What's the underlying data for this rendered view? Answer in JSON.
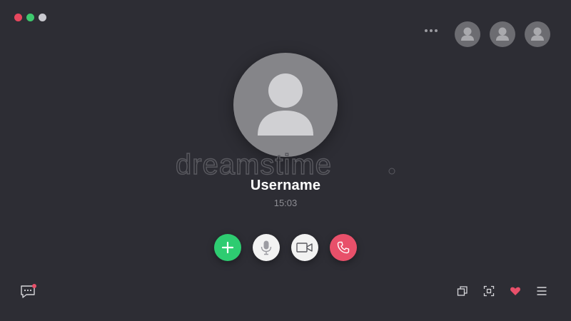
{
  "window": {
    "controls": [
      {
        "name": "close",
        "color": "#e7475e"
      },
      {
        "name": "minimize",
        "color": "#3ec96e"
      },
      {
        "name": "maximize",
        "color": "#c9c9cf"
      }
    ]
  },
  "call": {
    "username": "Username",
    "duration": "15:03"
  },
  "participants": [
    {
      "icon": "user-icon"
    },
    {
      "icon": "user-icon"
    },
    {
      "icon": "user-icon"
    }
  ],
  "controls": [
    {
      "name": "add-participant",
      "icon": "plus-icon",
      "color": "#2ecc71"
    },
    {
      "name": "microphone",
      "icon": "mic-icon",
      "color": "#f2f2f2"
    },
    {
      "name": "camera",
      "icon": "video-camera-icon",
      "color": "#f2f2f2"
    },
    {
      "name": "end-call",
      "icon": "phone-icon",
      "color": "#e8506a"
    }
  ],
  "bottom_left": {
    "icon": "chat-icon",
    "notification_color": "#e8506a"
  },
  "bottom_right": [
    {
      "icon": "window-switch-icon"
    },
    {
      "icon": "focus-icon"
    },
    {
      "icon": "heart-icon",
      "color": "#e8506a"
    },
    {
      "icon": "menu-icon"
    }
  ],
  "watermark": {
    "text": "dreamstime"
  }
}
